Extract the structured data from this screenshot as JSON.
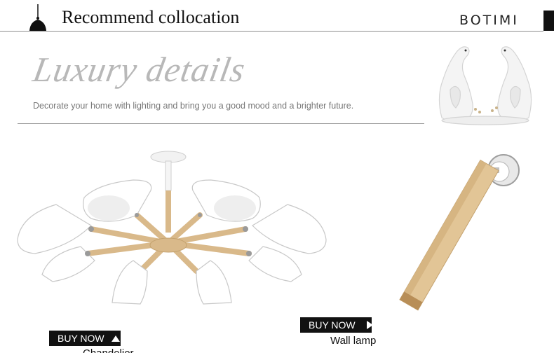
{
  "header": {
    "title": "Recommend collocation",
    "brand": "BOTIMI",
    "icon": "pendant-lamp-icon"
  },
  "banner": {
    "title": "Luxury details",
    "subtitle": "Decorate your home with lighting and bring you a good mood and a brighter future.",
    "image": "swan-figurines"
  },
  "products": [
    {
      "name": "Chandelier",
      "button_label": "BUY NOW",
      "button_icon": "arrow-up-icon"
    },
    {
      "name": "Wall lamp",
      "button_label": "BUY NOW",
      "button_icon": "arrow-right-icon"
    }
  ],
  "colors": {
    "button_bg": "#111111",
    "wood": "#d9b98a",
    "shade": "#ffffff"
  }
}
